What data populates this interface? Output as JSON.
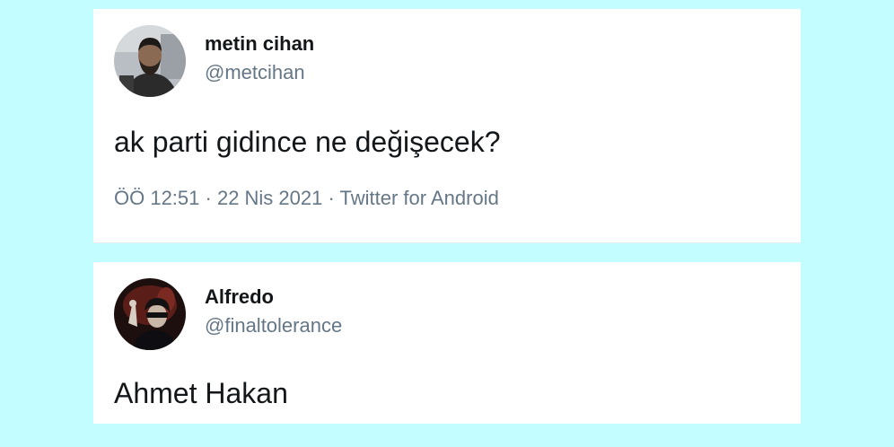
{
  "tweets": [
    {
      "name": "metin cihan",
      "handle": "@metcihan",
      "text": "ak parti gidince ne değişecek?",
      "time": "ÖÖ 12:51",
      "separator": " · ",
      "date": "22 Nis 2021",
      "source": "Twitter for Android"
    },
    {
      "name": "Alfredo",
      "handle": "@finaltolerance",
      "text": "Ahmet Hakan"
    }
  ],
  "colors": {
    "background": "#c4fdff",
    "card": "#ffffff",
    "primary_text": "#14171a",
    "secondary_text": "#657786"
  }
}
